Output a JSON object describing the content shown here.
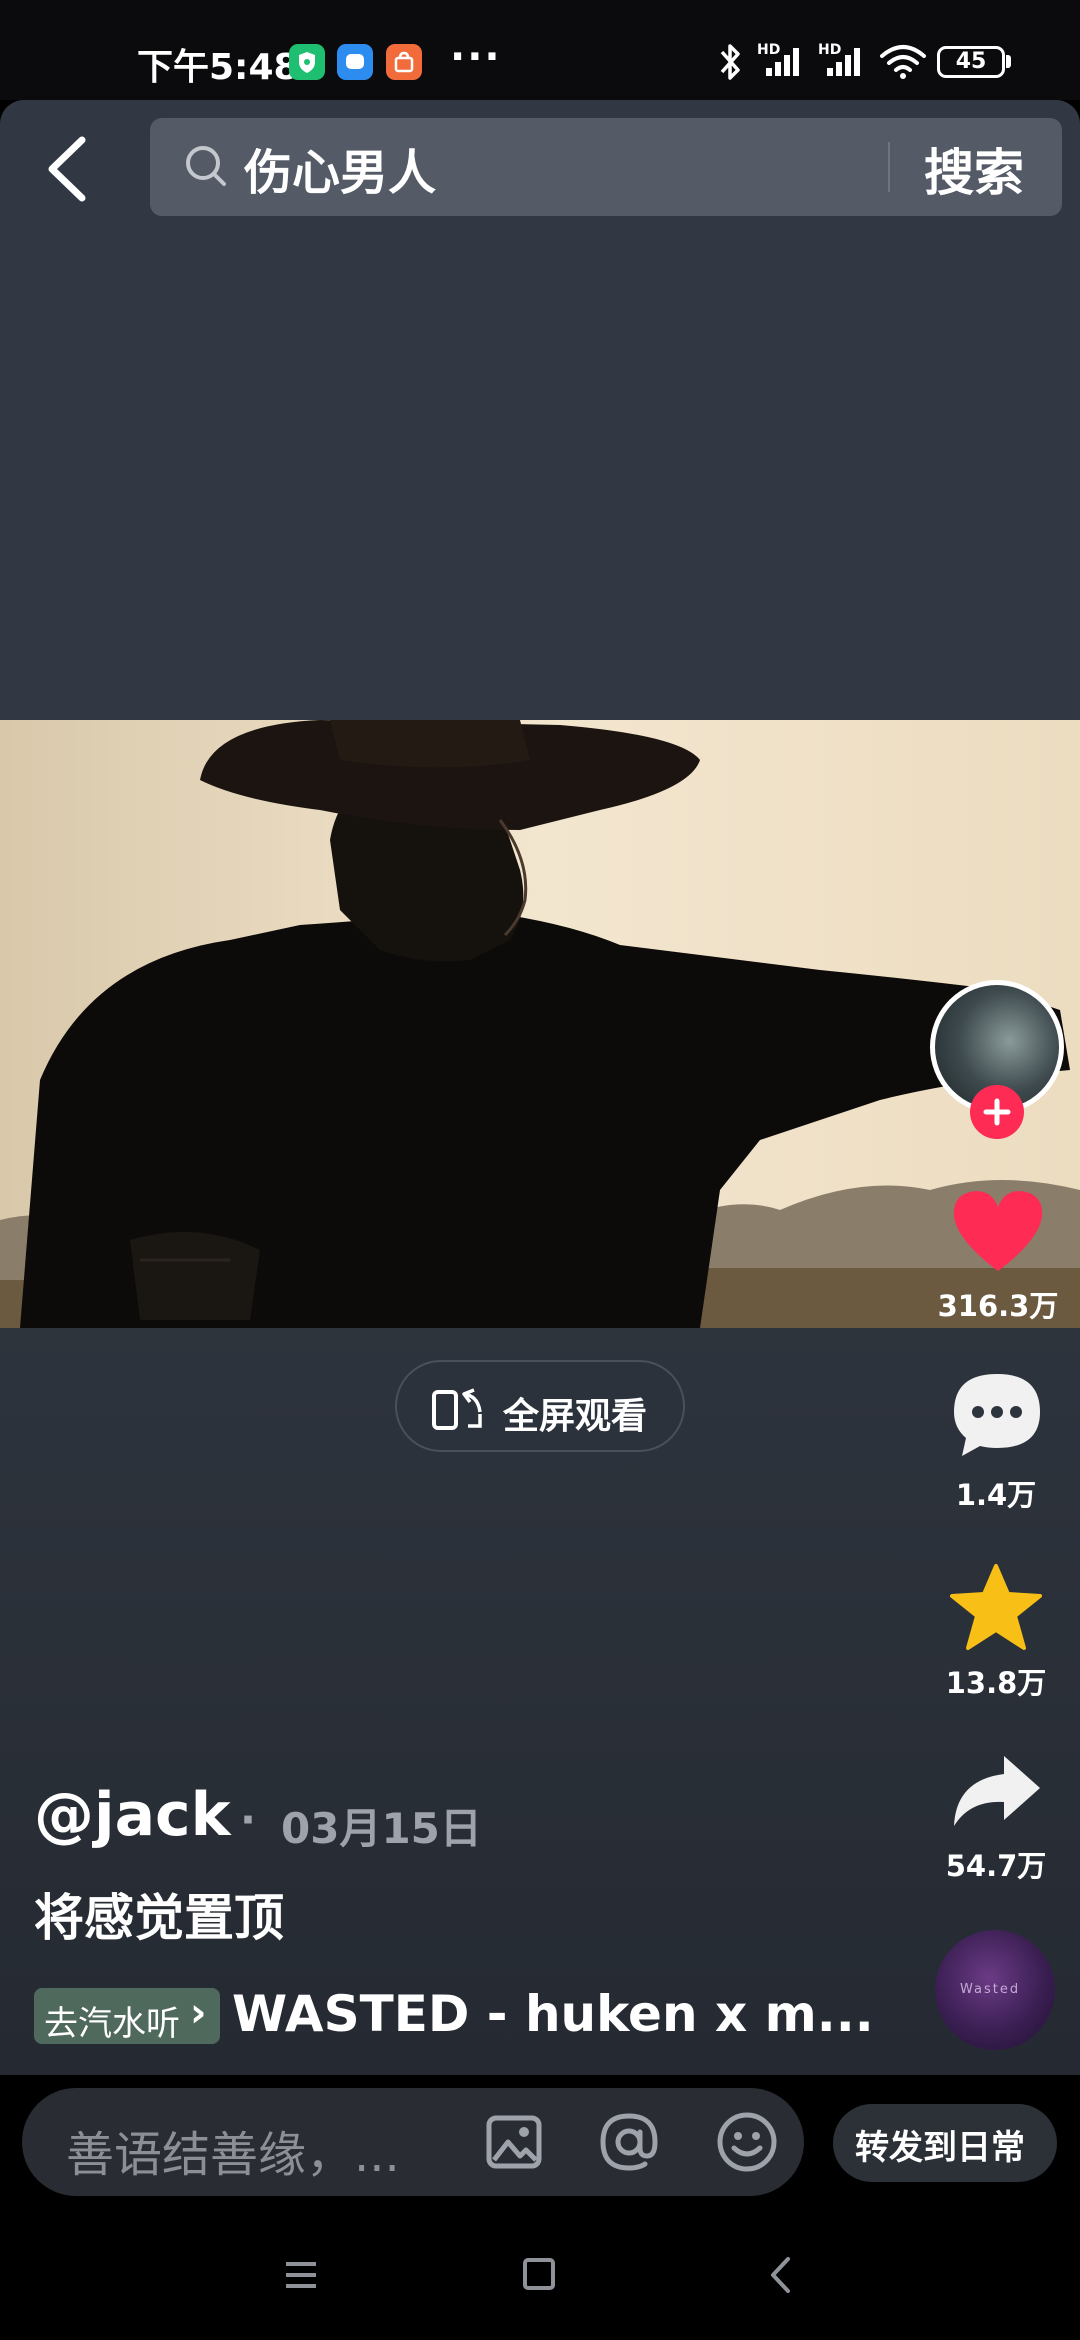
{
  "status_bar": {
    "time": "下午5:48",
    "more": "···",
    "network_label_1": "HD",
    "network_label_2": "HD",
    "battery": "45",
    "app_badge_colors": [
      "#1fbf72",
      "#2d8cf0",
      "#f26b3a"
    ]
  },
  "search": {
    "query": "伤心男人",
    "button_label": "搜索"
  },
  "video": {
    "fullscreen_label": "全屏观看"
  },
  "actions": {
    "like_count": "316.3万",
    "comment_count": "1.4万",
    "favorite_count": "13.8万",
    "share_count": "54.7万",
    "like_color": "#fe2c55",
    "favorite_color": "#f8c017"
  },
  "post": {
    "author": "@jack",
    "date_separator": "·",
    "date": "03月15日",
    "caption": "将感觉置顶",
    "music_chip_label": "去汽水听",
    "music_chip_arrow": "›",
    "music_title": "WASTED - huken x m...",
    "disc_text": "Wasted"
  },
  "comment_bar": {
    "placeholder": "善语结善缘，...",
    "share_daily_label": "转发到日常"
  }
}
